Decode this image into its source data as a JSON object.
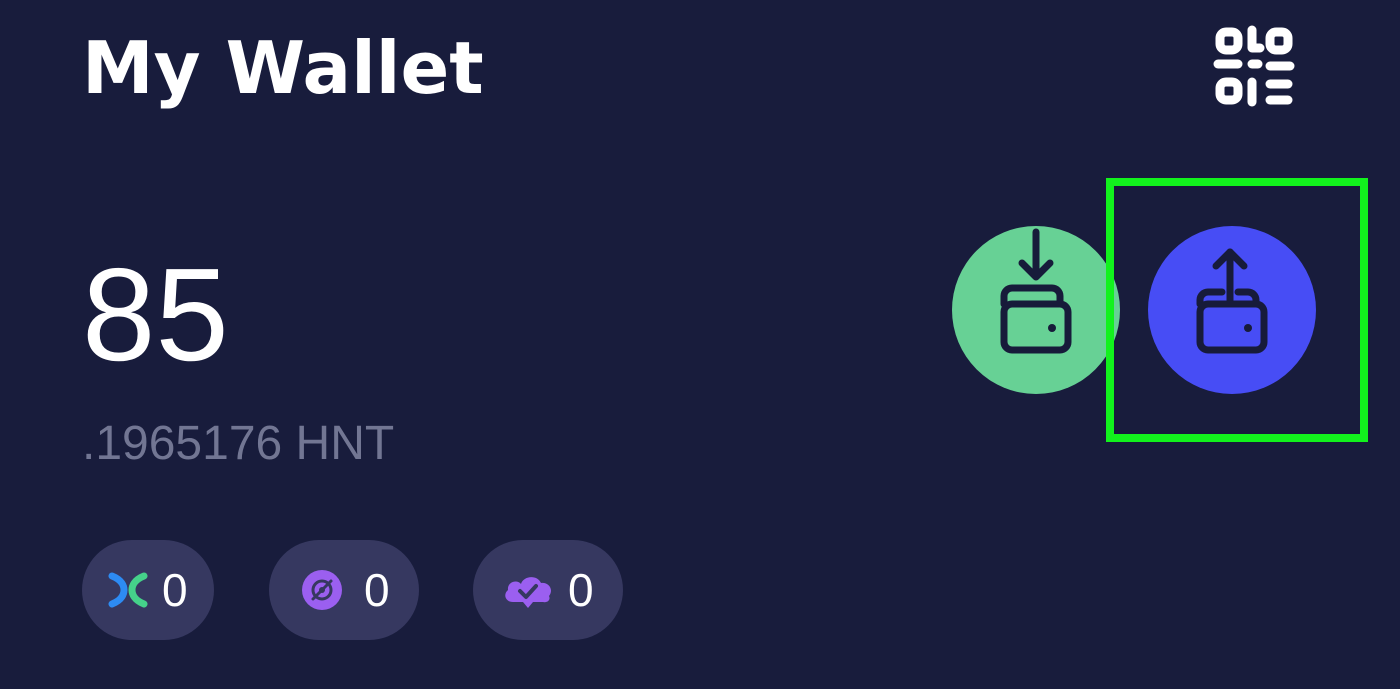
{
  "header": {
    "title": "My Wallet",
    "qr_icon": "qr-code-icon"
  },
  "balance": {
    "integer": "85",
    "fraction": ".1965176 HNT"
  },
  "actions": {
    "receive_icon": "wallet-receive-icon",
    "send_icon": "wallet-send-icon",
    "receive_color": "#67d195",
    "send_color": "#474df5",
    "highlight_color": "#12f21d"
  },
  "tokens": [
    {
      "icon": "mobile-token-icon",
      "value": "0"
    },
    {
      "icon": "helium-token-icon",
      "value": "0"
    },
    {
      "icon": "data-credits-cloud-icon",
      "value": "0"
    }
  ],
  "colors": {
    "background": "#181c3c",
    "pill": "#363860",
    "secondary_text": "#727693"
  }
}
